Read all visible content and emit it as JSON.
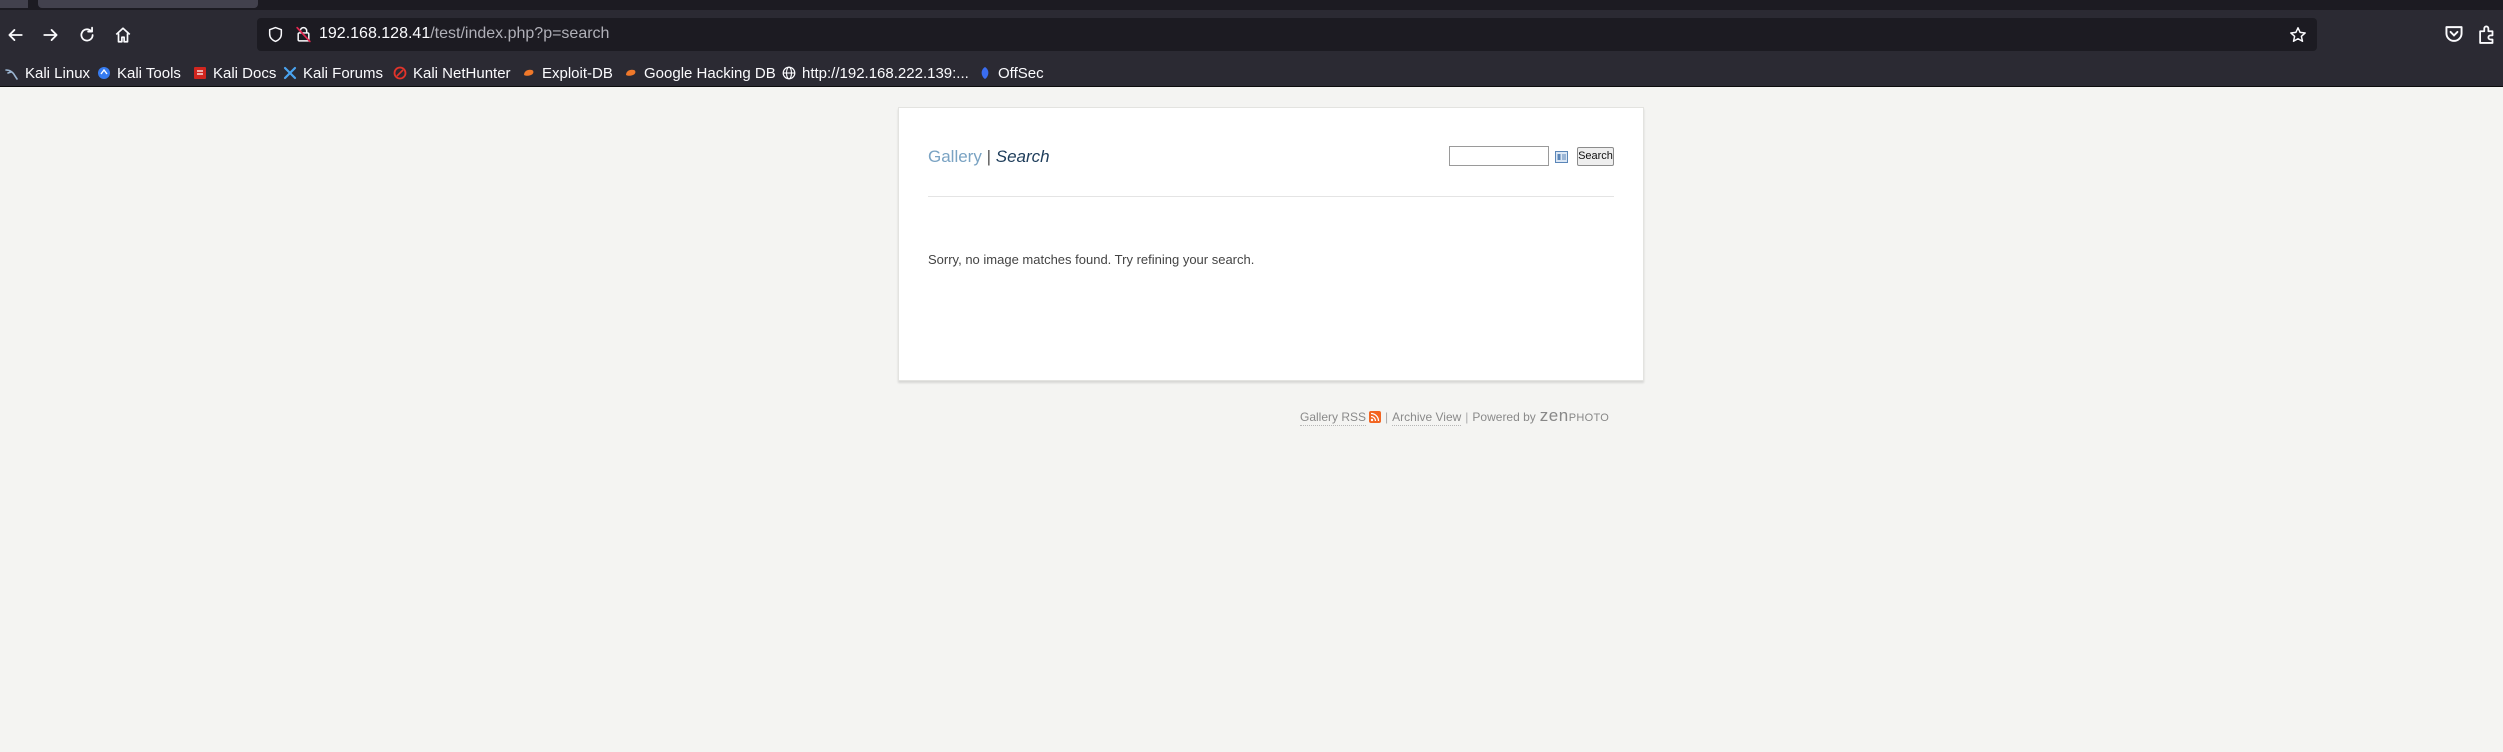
{
  "browser": {
    "url_host": "192.168.128.41",
    "url_path": "/test/index.php?p=search",
    "bookmarks": [
      {
        "label": "Kali Linux",
        "icon": "kali-dragon-icon"
      },
      {
        "label": "Kali Tools",
        "icon": "kali-tools-icon"
      },
      {
        "label": "Kali Docs",
        "icon": "kali-docs-icon"
      },
      {
        "label": "Kali Forums",
        "icon": "kali-forums-icon"
      },
      {
        "label": "Kali NetHunter",
        "icon": "nethunter-icon"
      },
      {
        "label": "Exploit-DB",
        "icon": "exploit-db-icon"
      },
      {
        "label": "Google Hacking DB",
        "icon": "ghdb-icon"
      },
      {
        "label": "http://192.168.222.139:...",
        "icon": "globe-icon"
      },
      {
        "label": "OffSec",
        "icon": "offsec-icon"
      }
    ]
  },
  "page": {
    "breadcrumb": {
      "gallery": "Gallery",
      "separator": "|",
      "current": "Search"
    },
    "search": {
      "value": "",
      "button": "Search"
    },
    "message": "Sorry, no image matches found. Try refining your search."
  },
  "footer": {
    "gallery_rss": "Gallery RSS",
    "separator": "|",
    "archive": "Archive View",
    "powered_by": "Powered by",
    "logo_main": "zen",
    "logo_small": "PHOTO"
  },
  "colors": {
    "chrome": "#2b2a33",
    "url_field": "#1c1b22",
    "page_bg": "#f4f4f2",
    "link": "#7aa3c3",
    "current": "#1d3c5a",
    "rss": "#f26522"
  }
}
